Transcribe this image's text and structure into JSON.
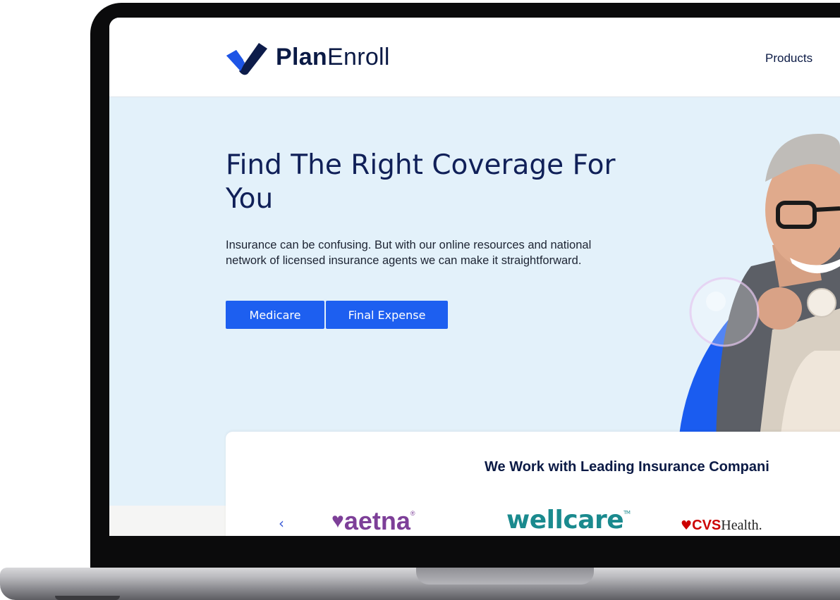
{
  "brand": {
    "name_bold": "Plan",
    "name_regular": "Enroll",
    "primary_color": "#1d5ff0",
    "navy_color": "#102058"
  },
  "nav": {
    "items": [
      {
        "label": "Products"
      }
    ]
  },
  "hero": {
    "title": "Find The Right Coverage For You",
    "subtitle": "Insurance can be confusing. But with our online resources and national network of licensed insurance agents we can make it straightforward.",
    "buttons": [
      {
        "label": "Medicare"
      },
      {
        "label": "Final Expense"
      }
    ],
    "background_color": "#e3f1fa"
  },
  "insurers": {
    "heading": "We Work with Leading Insurance Compani",
    "prev_icon": "chevron-left-icon",
    "logos": [
      {
        "name": "aetna",
        "mark": "♥",
        "color": "#7d3f98"
      },
      {
        "name": "wellcare",
        "color": "#1a8a8e"
      },
      {
        "name_bold": "CVS",
        "name_regular": "Health",
        "mark": "♥",
        "color": "#cc0000"
      }
    ]
  }
}
